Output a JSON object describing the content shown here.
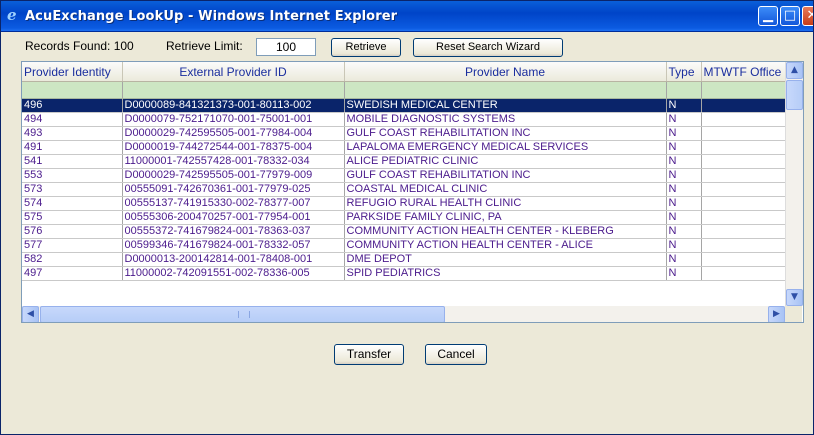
{
  "window": {
    "title": "AcuExchange LookUp - Windows Internet Explorer",
    "icon": "ie-icon"
  },
  "toolbar": {
    "records_label": "Records Found: 100",
    "limit_label": "Retrieve Limit:",
    "limit_value": "100",
    "retrieve_label": "Retrieve",
    "reset_label": "Reset Search Wizard"
  },
  "grid": {
    "columns": [
      "Provider Identity",
      "External Provider ID",
      "Provider Name",
      "Type",
      "MTWTF Office H"
    ],
    "rows": [
      {
        "id": "496",
        "ext": "D0000089-841321373-001-80113-002",
        "name": "SWEDISH MEDICAL CENTER",
        "type": "N",
        "hours": ""
      },
      {
        "id": "494",
        "ext": "D0000079-752171070-001-75001-001",
        "name": "MOBILE DIAGNOSTIC SYSTEMS",
        "type": "N",
        "hours": ""
      },
      {
        "id": "493",
        "ext": "D0000029-742595505-001-77984-004",
        "name": "GULF COAST REHABILITATION INC",
        "type": "N",
        "hours": ""
      },
      {
        "id": "491",
        "ext": "D0000019-744272544-001-78375-004",
        "name": "LAPALOMA EMERGENCY MEDICAL SERVICES",
        "type": "N",
        "hours": ""
      },
      {
        "id": "541",
        "ext": "11000001-742557428-001-78332-034",
        "name": "ALICE PEDIATRIC CLINIC",
        "type": "N",
        "hours": ""
      },
      {
        "id": "553",
        "ext": "D0000029-742595505-001-77979-009",
        "name": "GULF COAST REHABILITATION INC",
        "type": "N",
        "hours": ""
      },
      {
        "id": "573",
        "ext": "00555091-742670361-001-77979-025",
        "name": "COASTAL MEDICAL CLINIC",
        "type": "N",
        "hours": ""
      },
      {
        "id": "574",
        "ext": "00555137-741915330-002-78377-007",
        "name": "REFUGIO RURAL HEALTH CLINIC",
        "type": "N",
        "hours": ""
      },
      {
        "id": "575",
        "ext": "00555306-200470257-001-77954-001",
        "name": "PARKSIDE FAMILY CLINIC, PA",
        "type": "N",
        "hours": ""
      },
      {
        "id": "576",
        "ext": "00555372-741679824-001-78363-037",
        "name": "COMMUNITY ACTION HEALTH CENTER - KLEBERG",
        "type": "N",
        "hours": ""
      },
      {
        "id": "577",
        "ext": "00599346-741679824-001-78332-057",
        "name": "COMMUNITY ACTION HEALTH CENTER - ALICE",
        "type": "N",
        "hours": ""
      },
      {
        "id": "582",
        "ext": "D0000013-200142814-001-78408-001",
        "name": "DME DEPOT",
        "type": "N",
        "hours": ""
      },
      {
        "id": "497",
        "ext": "11000002-742091551-002-78336-005",
        "name": "SPID PEDIATRICS",
        "type": "N",
        "hours": ""
      }
    ]
  },
  "footer": {
    "transfer_label": "Transfer",
    "cancel_label": "Cancel"
  },
  "colors": {
    "title_bar": "#0a5fd9",
    "selected_row": "#0a246a",
    "search_row": "#cde6c3",
    "row_text": "#4a1a8c"
  }
}
